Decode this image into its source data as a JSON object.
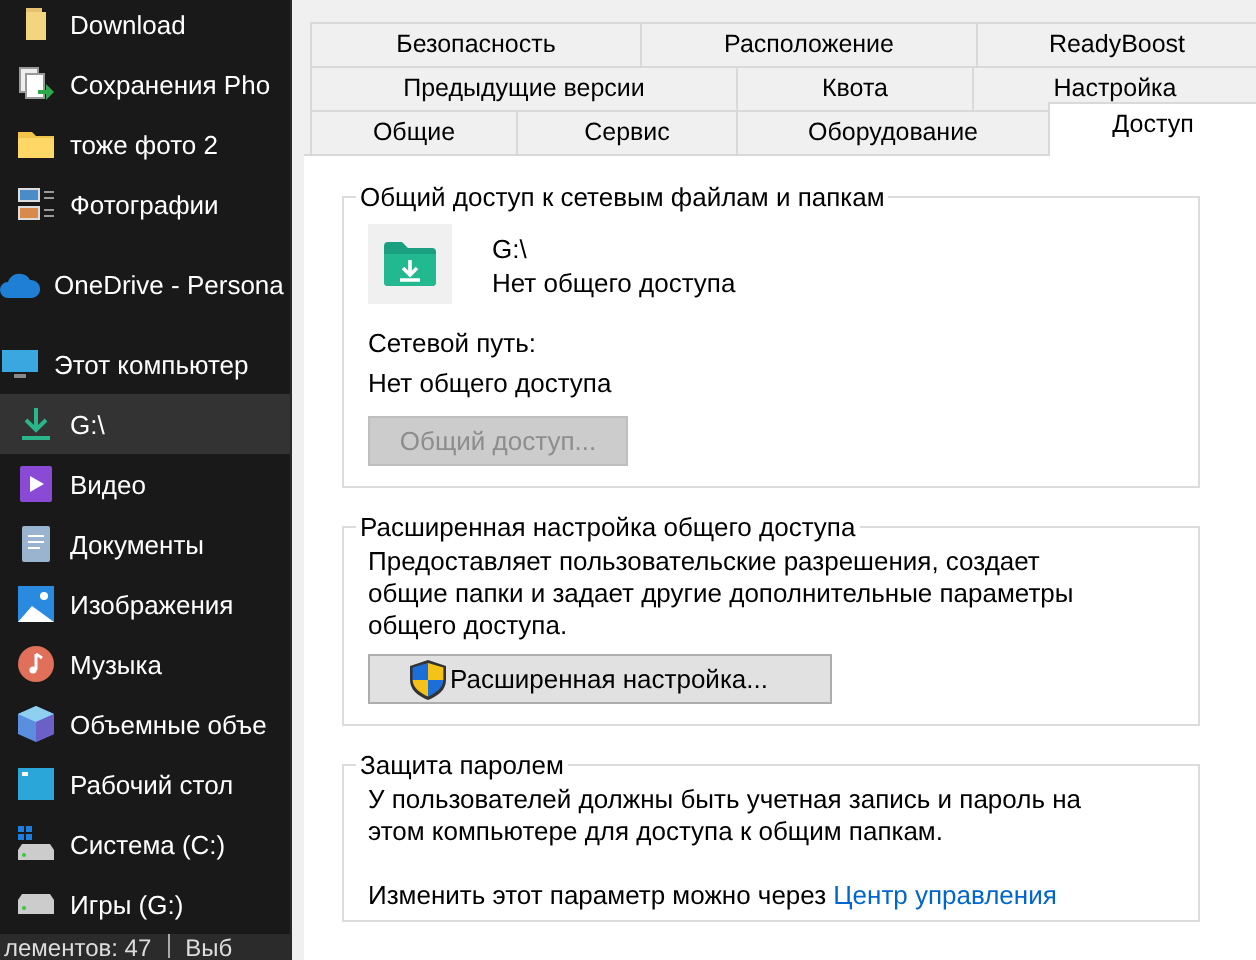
{
  "sidebar": {
    "pinned": [
      {
        "label": "Download",
        "kind": "folder-plain",
        "selected": false
      },
      {
        "label": "Сохранения Pho",
        "kind": "copy",
        "selected": false
      },
      {
        "label": "тоже фото 2",
        "kind": "folder",
        "selected": false
      },
      {
        "label": "Фотографии",
        "kind": "gallery",
        "selected": false
      }
    ],
    "items": [
      {
        "label": "OneDrive - Persona",
        "kind": "cloud",
        "selected": false
      },
      {
        "label": "Этот компьютер",
        "kind": "monitor",
        "selected": false,
        "children": [
          {
            "label": "G:\\",
            "kind": "download",
            "selected": true
          },
          {
            "label": "Видео",
            "kind": "video",
            "selected": false
          },
          {
            "label": "Документы",
            "kind": "document",
            "selected": false
          },
          {
            "label": "Изображения",
            "kind": "picture",
            "selected": false
          },
          {
            "label": "Музыка",
            "kind": "music",
            "selected": false
          },
          {
            "label": "Объемные объе",
            "kind": "cube",
            "selected": false
          },
          {
            "label": "Рабочий стол",
            "kind": "desktop",
            "selected": false
          },
          {
            "label": "Система (C:)",
            "kind": "system-drive",
            "selected": false
          },
          {
            "label": "Игры (G:)",
            "kind": "drive",
            "selected": false
          }
        ]
      }
    ],
    "status_bar": [
      "лементов: 47",
      "Выб"
    ]
  },
  "tab_rows": [
    [
      {
        "label": "Безопасность",
        "selected": false
      },
      {
        "label": "Расположение",
        "selected": false
      },
      {
        "label": "ReadyBoost",
        "selected": false
      }
    ],
    [
      {
        "label": "Предыдущие версии",
        "selected": false
      },
      {
        "label": "Квота",
        "selected": false
      },
      {
        "label": "Настройка",
        "selected": false
      }
    ],
    [
      {
        "label": "Общие",
        "selected": false
      },
      {
        "label": "Сервис",
        "selected": false
      },
      {
        "label": "Оборудование",
        "selected": false
      },
      {
        "label": "Доступ",
        "selected": true
      }
    ]
  ],
  "network_sharing": {
    "title": "Общий доступ к сетевым файлам и папкам",
    "drive": "G:\\",
    "status": "Нет общего доступа",
    "path_label": "Сетевой путь:",
    "path_value": "Нет общего доступа",
    "button": {
      "label": "Общий доступ...",
      "disabled": true
    }
  },
  "advanced_sharing": {
    "title": "Расширенная настройка общего доступа",
    "description": "Предоставляет пользовательские разрешения, создает общие папки и задает другие дополнительные параметры общего доступа.",
    "button": {
      "label": "Расширенная настройка...",
      "disabled": false
    }
  },
  "password_protection": {
    "title": "Защита паролем",
    "description": "У пользователей должны быть учетная запись и пароль на этом компьютере для доступа к общим папкам.",
    "change_text": "Изменить этот параметр можно через",
    "link": "Центр управления"
  }
}
